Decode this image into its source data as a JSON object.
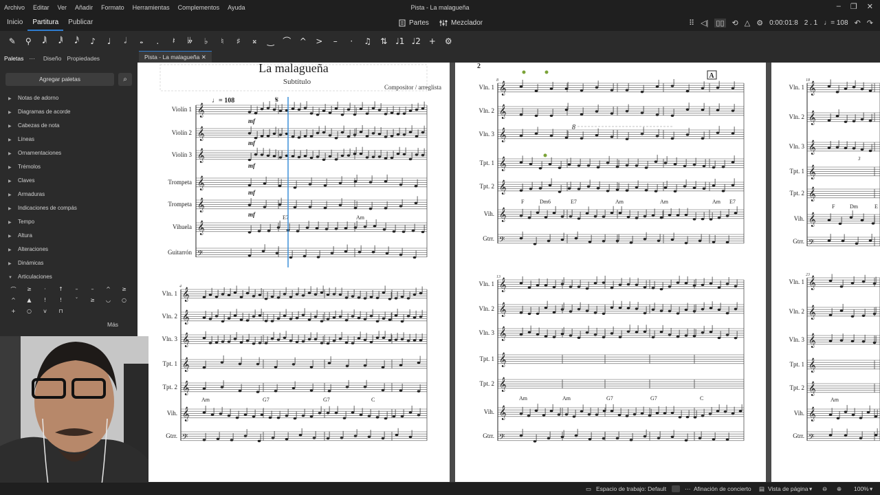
{
  "menu": {
    "items": [
      "Archivo",
      "Editar",
      "Ver",
      "Añadir",
      "Formato",
      "Herramientas",
      "Complementos",
      "Ayuda"
    ],
    "window_title": "Pista - La malagueña",
    "controls": [
      "–",
      "❐",
      "✕"
    ]
  },
  "tabs": {
    "items": [
      "Inicio",
      "Partitura",
      "Publicar"
    ],
    "active": "Partitura"
  },
  "center": {
    "parts_label": "Partes",
    "mixer_label": "Mezclador"
  },
  "playback": {
    "time": "0:00:01:8",
    "position": "2 . 1",
    "tempo": "♩= 108"
  },
  "toolbar_icons": [
    "pencil",
    "pin",
    "64th-note",
    "32nd-note",
    "16th-note",
    "eighth-note",
    "quarter-note",
    "half-note",
    "whole-note",
    "dot",
    "rest",
    "double-flat",
    "flat",
    "natural",
    "sharp",
    "double-sharp",
    "tie",
    "slur",
    "marcato",
    "accent",
    "tenuto",
    "staccato",
    "tuplet",
    "flip",
    "voice-1",
    "voice-2",
    "add",
    "settings"
  ],
  "toolbar_glyphs": [
    "✎",
    "⚲",
    "𝅘𝅥𝅲",
    "𝅘𝅥𝅱",
    "𝅘𝅥𝅰",
    "♪",
    "♩",
    "𝅗𝅥",
    "𝅝",
    ".",
    "𝄽",
    "𝄫",
    "♭",
    "♮",
    "♯",
    "𝄪",
    "‿",
    "⌒",
    "^",
    ">",
    "–",
    "·",
    "♫",
    "⇅",
    "♩1",
    "♩2",
    "+",
    "⚙"
  ],
  "panel": {
    "tabs": [
      "Paletas",
      "Diseño",
      "Propiedades"
    ],
    "add_palettes": "Agregar paletas",
    "palettes": [
      "Notas de adorno",
      "Diagramas de acorde",
      "Cabezas de nota",
      "Líneas",
      "Ornamentaciones",
      "Trémolos",
      "Claves",
      "Armaduras",
      "Indicaciones de compás",
      "Tempo",
      "Altura",
      "Alteraciones",
      "Dinámicas",
      "Articulaciones"
    ],
    "articulations": [
      "⌒",
      "≥",
      "·",
      "↑",
      "–",
      "–",
      "^",
      "≥",
      "^",
      "▲",
      "!",
      "!",
      "ˇ",
      "≥",
      "◡",
      "○",
      "+",
      "○",
      "v",
      "⊓"
    ],
    "more": "Más"
  },
  "doc_tab": {
    "label": "Pista - La malagueña",
    "close": "✕"
  },
  "score": {
    "page1": {
      "title": "La malagueña",
      "subtitle": "Subtítulo",
      "composer": "Compositor / arreglista",
      "tempo": "♩= 108",
      "segno": "𝄋",
      "dynamic": "mf",
      "instruments": [
        "Violín 1",
        "Violín 2",
        "Violín 3",
        "Trompeta",
        "Trompeta",
        "Vihuela",
        "Guitarrón"
      ],
      "chords": [
        "E7",
        "Am"
      ],
      "system2_instruments": [
        "Vln. 1",
        "Vln. 2",
        "Vln. 3",
        "Tpt. 1",
        "Tpt. 2",
        "Vih.",
        "Gtrr."
      ],
      "system2_chords": [
        "Am",
        "G7",
        "G7",
        "C"
      ],
      "system2_measure": "4"
    },
    "page2": {
      "page_number": "2",
      "rehearsal": "A",
      "octave": "8",
      "system1_instruments": [
        "Vln. 1",
        "Vln. 2",
        "Vln. 3",
        "Tpt. 1",
        "Tpt. 2",
        "Vih.",
        "Gtrr."
      ],
      "system1_chords": [
        "F",
        "Dm6",
        "E7",
        "Am",
        "Am",
        "Am",
        "E7"
      ],
      "system1_measure": "8",
      "system2_instruments": [
        "Vln. 1",
        "Vln. 2",
        "Vln. 3",
        "Tpt. 1",
        "Tpt. 2",
        "Vih.",
        "Gtrr."
      ],
      "system2_chords": [
        "Am",
        "Am",
        "G7",
        "G7",
        "C"
      ],
      "system2_measure": "13"
    },
    "page3": {
      "system1_instruments": [
        "Vln. 1",
        "Vln. 2",
        "Vln. 3",
        "Tpt. 1",
        "Tpt. 2",
        "Vih.",
        "Gtrr."
      ],
      "system1_chords": [
        "F",
        "Dm",
        "E"
      ],
      "system1_measure": "18",
      "tuplet": "3",
      "system2_instruments": [
        "Vln. 1",
        "Vln. 2",
        "Vln. 3",
        "Tpt. 1",
        "Tpt. 2",
        "Vih.",
        "Gtrr."
      ],
      "system2_chords": [
        "Am"
      ],
      "system2_measure": "23"
    }
  },
  "status": {
    "workspace": "Espacio de trabajo: Default",
    "concert": "Afinación de concierto",
    "view": "Vista de página",
    "zoom": "100%"
  },
  "colors": {
    "accent": "#2f7dd1",
    "cursor": "#3b8fd9",
    "page": "#ffffff",
    "canvas": "#4a4a4a"
  }
}
